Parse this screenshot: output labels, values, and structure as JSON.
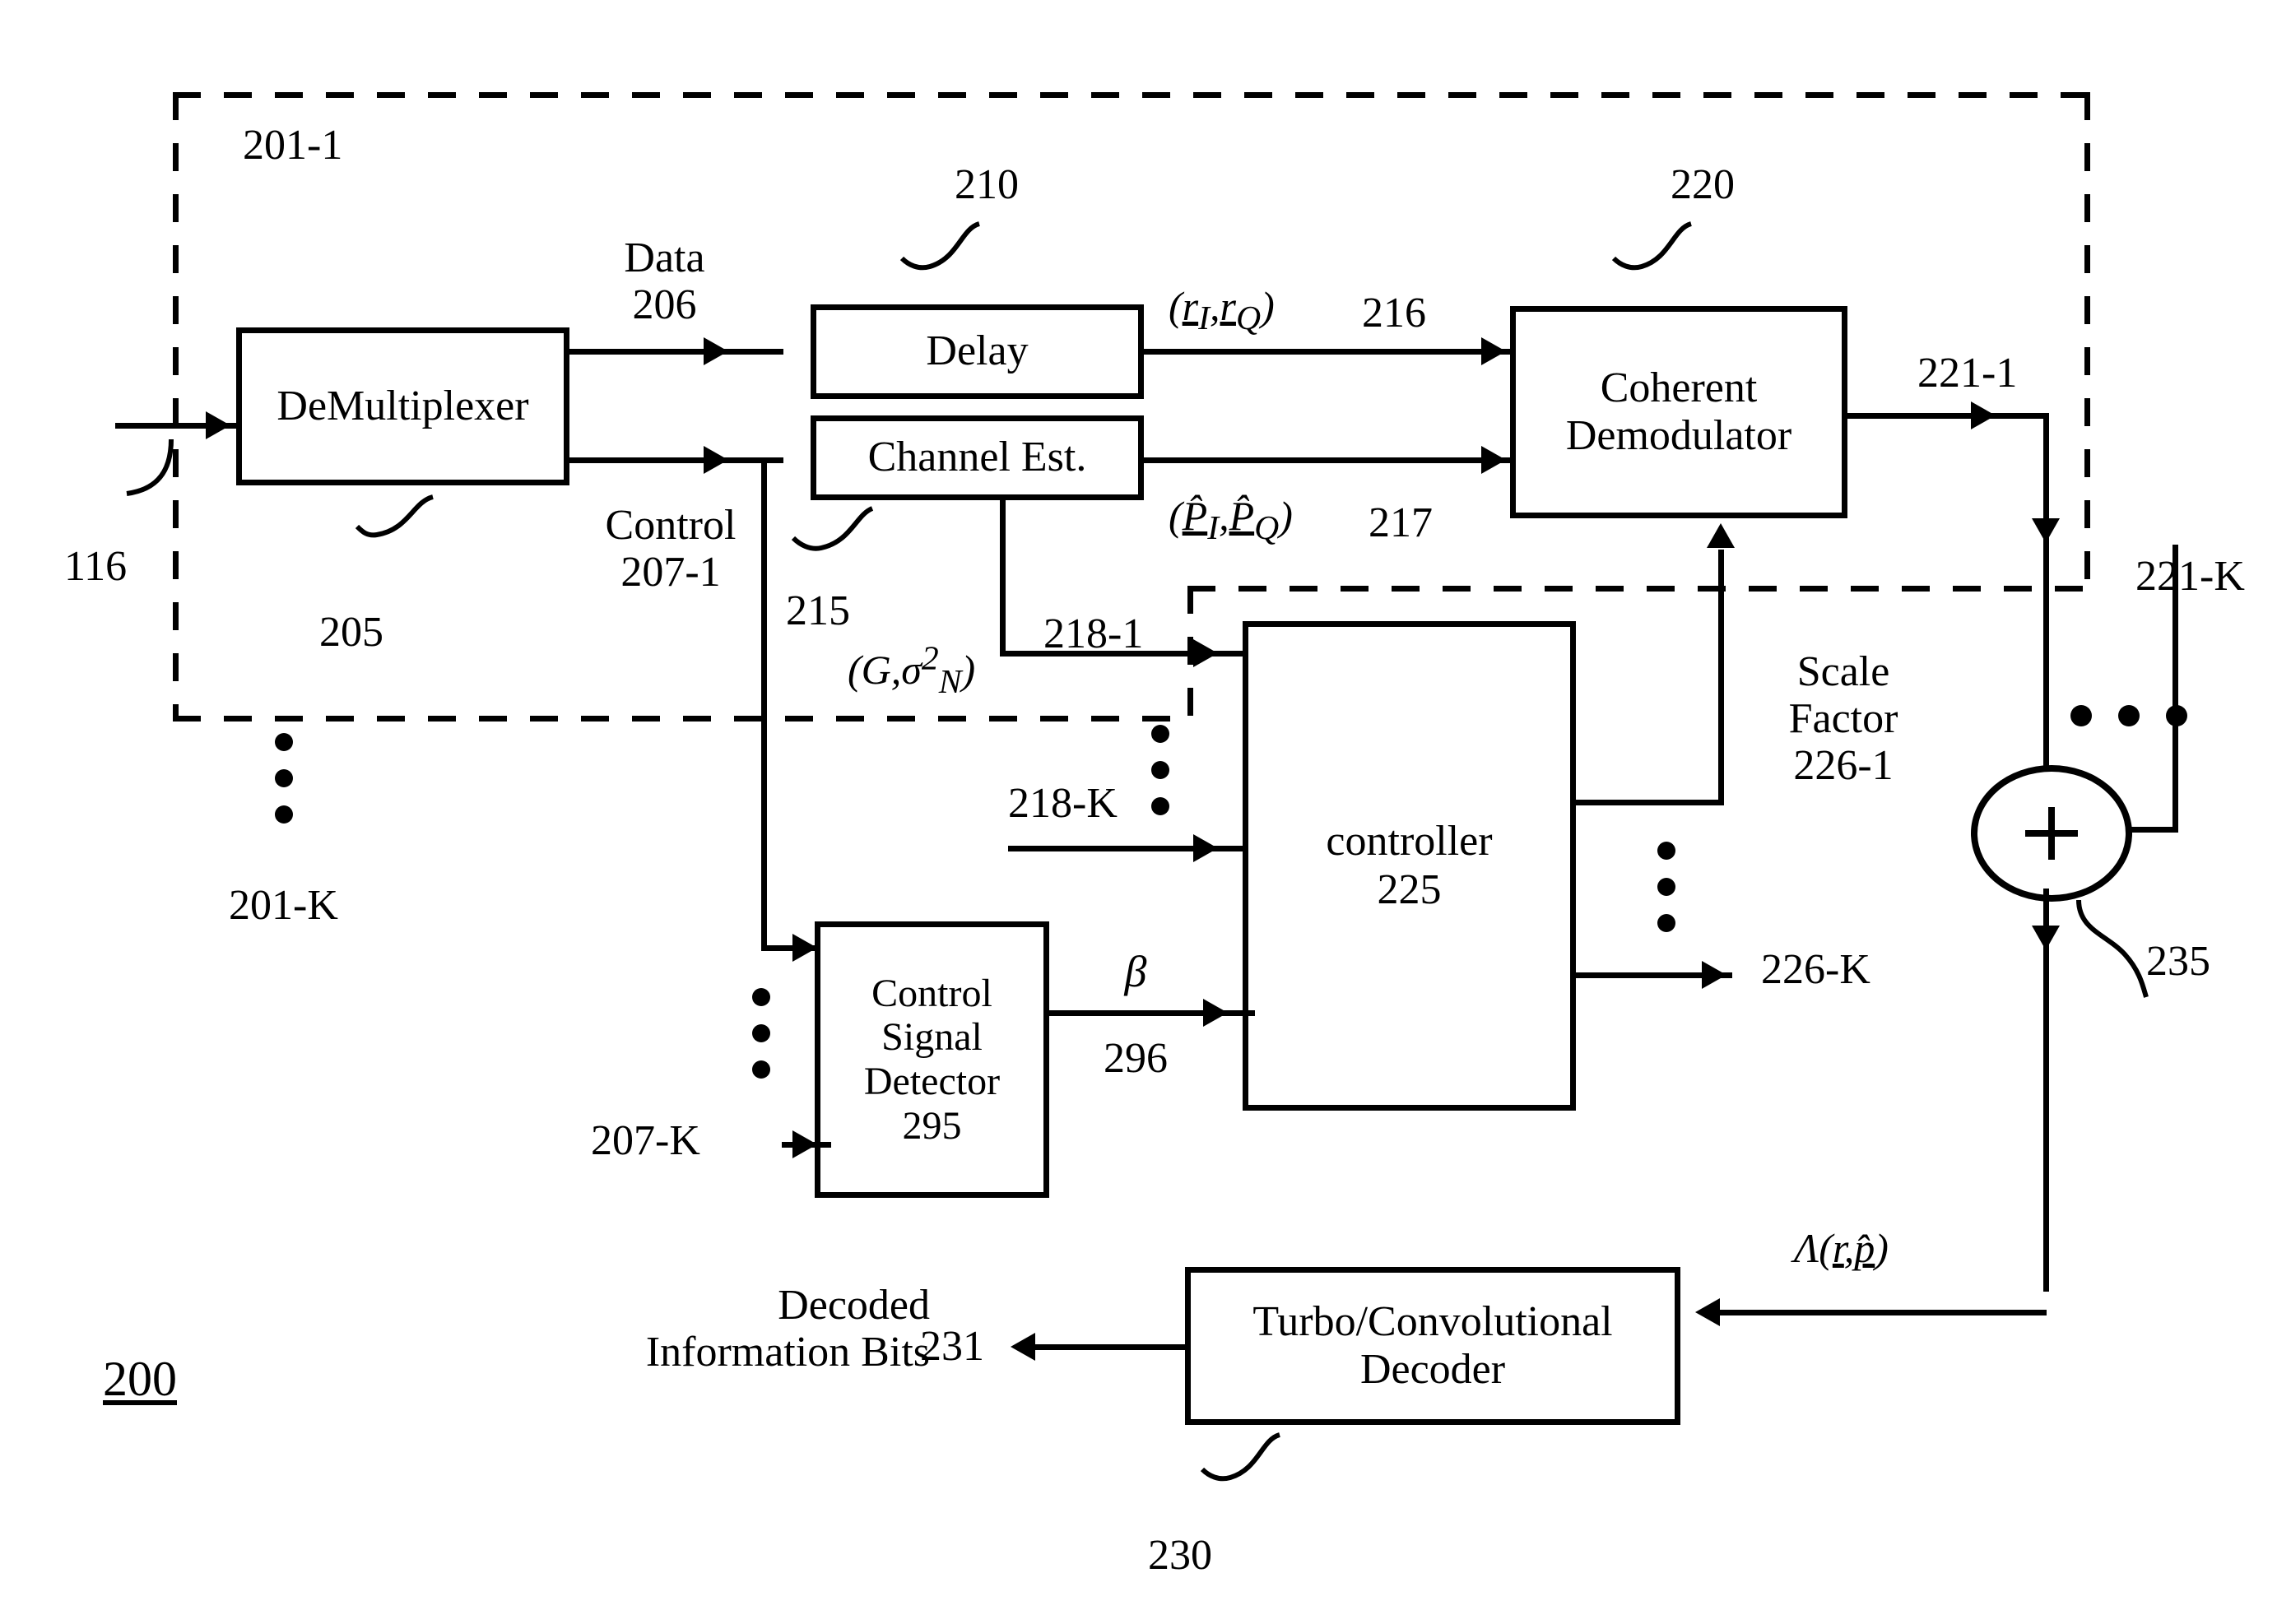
{
  "figure": {
    "number": "200",
    "dashed_group_top_label": "201-1",
    "dashed_group_bottom_label": "201-K"
  },
  "blocks": [
    {
      "id": "demux",
      "lines": [
        "DeMultiplexer"
      ],
      "ref": "205"
    },
    {
      "id": "delay",
      "lines": [
        "Delay"
      ],
      "ref": "210"
    },
    {
      "id": "chanest",
      "lines": [
        "Channel Est."
      ],
      "ref": "215"
    },
    {
      "id": "cohdemod",
      "lines": [
        "Coherent",
        "Demodulator"
      ],
      "ref": "220"
    },
    {
      "id": "controller",
      "lines": [
        "controller",
        "225"
      ],
      "ref": ""
    },
    {
      "id": "csd",
      "lines": [
        "Control",
        "Signal",
        "Detector",
        "295"
      ],
      "ref": ""
    },
    {
      "id": "decoder",
      "lines": [
        "Turbo/Convolutional",
        "Decoder"
      ],
      "ref": "230"
    }
  ],
  "labels": {
    "input_116": "116",
    "data": "Data",
    "data_ref": "206",
    "control": "Control",
    "control_ref": "207-1",
    "control_k": "207-K",
    "demux_ref": "205",
    "delay_ref": "210",
    "chanest_ref": "215",
    "cohdemod_ref": "220",
    "decoder_ref": "230",
    "r_iq": "(r_I , r_Q)",
    "r_iq_ref": "216",
    "p_iq": "(P̂_I , P̂_Q)",
    "p_iq_ref": "217",
    "g_sigma": "(G, σ²_N)",
    "g_sigma_ref": "218-1",
    "input_218k": "218-K",
    "scale_factor_l1": "Scale",
    "scale_factor_l2": "Factor",
    "scale_factor_ref": "226-1",
    "scale_factor_k": "226-K",
    "beta": "β",
    "beta_ref": "296",
    "out_221_1": "221-1",
    "out_221_k": "221-K",
    "sum_ref": "235",
    "lambda": "Λ(r, p̂)",
    "decoded_l1": "Decoded",
    "decoded_l2": "Information Bits",
    "decoded_ref": "231",
    "fig_num": "200"
  },
  "colors": {
    "ink": "#000000",
    "paper": "#ffffff"
  }
}
